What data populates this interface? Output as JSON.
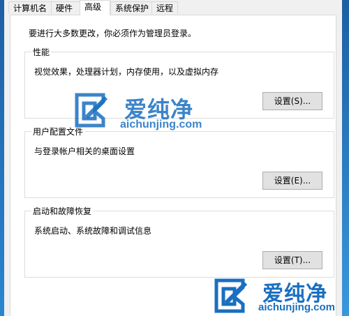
{
  "tabs": [
    {
      "label": "计算机名",
      "active": false
    },
    {
      "label": "硬件",
      "active": false
    },
    {
      "label": "高级",
      "active": true
    },
    {
      "label": "系统保护",
      "active": false
    },
    {
      "label": "远程",
      "active": false
    }
  ],
  "note": "要进行大多数更改，你必须作为管理员登录。",
  "groups": [
    {
      "title": "性能",
      "description": "视觉效果，处理器计划，内存使用，以及虚拟内存",
      "button": "设置(S)..."
    },
    {
      "title": "用户配置文件",
      "description": "与登录帐户相关的桌面设置",
      "button": "设置(E)..."
    },
    {
      "title": "启动和故障恢复",
      "description": "系统启动、系统故障和调试信息",
      "button": "设置(T)..."
    }
  ],
  "watermark": {
    "brand": "爱纯净",
    "url": "aichunjing.com",
    "color": "#1a6fc0"
  }
}
